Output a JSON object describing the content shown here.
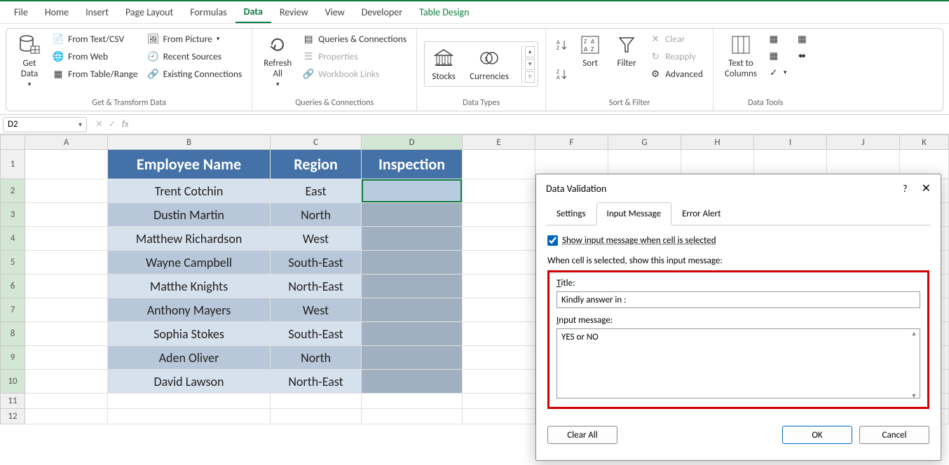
{
  "menubar": {
    "file": "File",
    "home": "Home",
    "insert": "Insert",
    "page_layout": "Page Layout",
    "formulas": "Formulas",
    "data": "Data",
    "review": "Review",
    "view": "View",
    "developer": "Developer",
    "table_design": "Table Design"
  },
  "ribbon": {
    "get_data": "Get\nData",
    "from_text_csv": "From Text/CSV",
    "from_web": "From Web",
    "from_table_range": "From Table/Range",
    "from_picture": "From Picture",
    "recent_sources": "Recent Sources",
    "existing_connections": "Existing Connections",
    "group_get_transform": "Get & Transform Data",
    "refresh_all": "Refresh\nAll",
    "queries_connections": "Queries & Connections",
    "properties": "Properties",
    "workbook_links": "Workbook Links",
    "group_queries": "Queries & Connections",
    "stocks": "Stocks",
    "currencies": "Currencies",
    "group_datatypes": "Data Types",
    "sort": "Sort",
    "filter": "Filter",
    "clear": "Clear",
    "reapply": "Reapply",
    "advanced": "Advanced",
    "group_sortfilter": "Sort & Filter",
    "text_to_columns": "Text to\nColumns",
    "group_datatools": "Data Tools"
  },
  "namebox": {
    "value": "D2"
  },
  "columns": [
    "A",
    "B",
    "C",
    "D",
    "E",
    "F",
    "G",
    "H",
    "I",
    "J",
    "K"
  ],
  "table": {
    "headers": {
      "b": "Employee Name",
      "c": "Region",
      "d": "Inspection"
    },
    "rows": [
      {
        "b": "Trent Cotchin",
        "c": "East"
      },
      {
        "b": "Dustin Martin",
        "c": "North"
      },
      {
        "b": "Matthew Richardson",
        "c": "West"
      },
      {
        "b": "Wayne Campbell",
        "c": "South-East"
      },
      {
        "b": "Matthe Knights",
        "c": "North-East"
      },
      {
        "b": "Anthony Mayers",
        "c": "West"
      },
      {
        "b": "Sophia Stokes",
        "c": "South-East"
      },
      {
        "b": "Aden Oliver",
        "c": "North"
      },
      {
        "b": "David Lawson",
        "c": "North-East"
      }
    ]
  },
  "dialog": {
    "title": "Data Validation",
    "help": "?",
    "tabs": {
      "settings": "Settings",
      "input_message": "Input Message",
      "error_alert": "Error Alert"
    },
    "checkbox_label": "Show input message when cell is selected",
    "section_label": "When cell is selected, show this input message:",
    "title_label": "Title:",
    "title_value": "Kindly answer in :",
    "msg_label": "Input message:",
    "msg_value": "YES or NO",
    "clear_all": "Clear All",
    "ok": "OK",
    "cancel": "Cancel"
  }
}
